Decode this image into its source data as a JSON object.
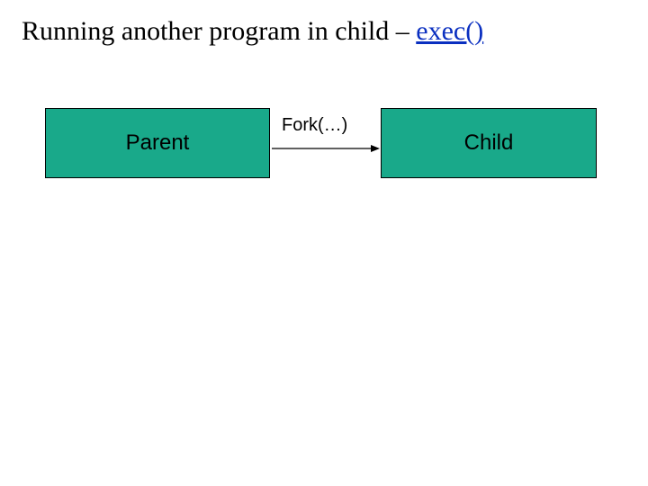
{
  "title": {
    "prefix": "Running another program in child – ",
    "exec": "exec()"
  },
  "parent_label": "Parent",
  "child_label": "Child",
  "fork_label": "Fork(…)"
}
